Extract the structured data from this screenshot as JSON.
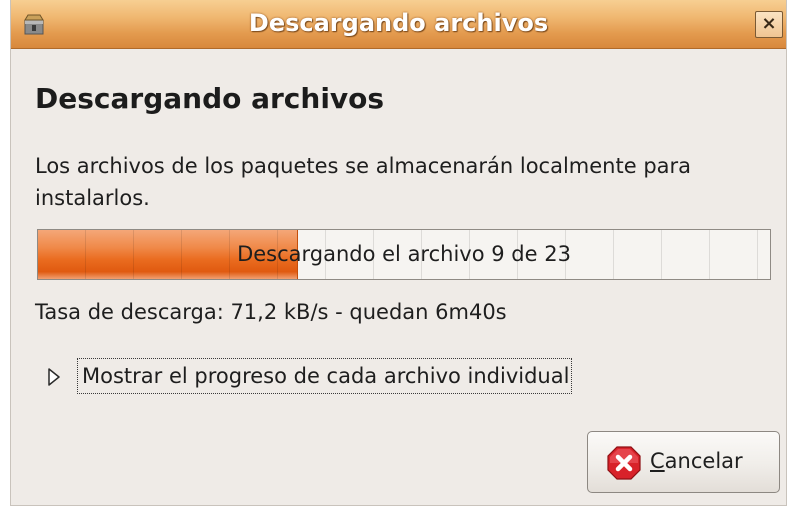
{
  "window": {
    "title": "Descargando archivos",
    "close_label": "×"
  },
  "heading": "Descargando archivos",
  "description": "Los archivos de los paquetes se almacenarán localmente para instalarlos.",
  "progress": {
    "fraction": 0.355,
    "text": "Descargando el archivo 9 de 23"
  },
  "rate_text": "Tasa de descarga: 71,2 kB/s - quedan 6m40s",
  "expander": {
    "label": "Mostrar el progreso de cada archivo individual",
    "icon": "triangle-right-icon"
  },
  "cancel": {
    "mnemonic": "C",
    "label_rest": "ancelar",
    "icon": "stop-icon"
  },
  "colors": {
    "titlebar": "#e39a4e",
    "progress_fill": "#ea6c20",
    "window_bg": "#efebe7"
  }
}
